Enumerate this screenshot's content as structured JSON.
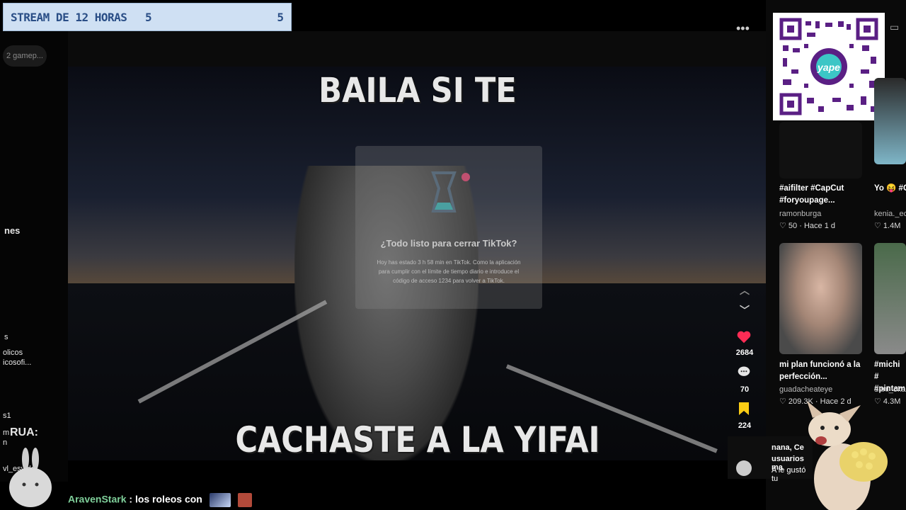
{
  "scoreboard": {
    "label": "STREAM DE 12 HORAS",
    "score_left": "5",
    "score_right": "5"
  },
  "left_chat": {
    "chip": "2 gamep...",
    "fragments": [
      "nes",
      "s",
      "olicos",
      "icosofi...",
      "s1",
      "RUA:",
      "m",
      "n",
      "vl_esvida"
    ]
  },
  "video": {
    "caption_top": "BAILA SI TE",
    "caption_bottom": "CACHASTE A LA YIFAI",
    "dialog_title": "¿Todo listo para cerrar TikTok?",
    "dialog_body": "Hoy has estado 3 h 58 min en TikTok. Como la aplicación para cumplir con el límite de tiempo diario e introduce el código de acceso 1234 para volver a TikTok."
  },
  "actions": {
    "more": "•••",
    "likes": "2684",
    "comments": "70",
    "saves": "224",
    "colors": {
      "like": "#fe2c55",
      "save": "#facc15"
    }
  },
  "cards": [
    {
      "title": "#aifilter #CapCut #foryoupage...",
      "user": "ramonburga",
      "likes": "50",
      "time": "Hace 1 d"
    },
    {
      "title": "Yo 😝 #C #popula",
      "user": "kenia._ec",
      "likes": "1.4M",
      "time": ""
    },
    {
      "title": "mi plan funcionó a la perfección...",
      "user": "guadacheateye",
      "likes": "209.3K",
      "time": "Hace 2 d"
    },
    {
      "title": "#michi # #pintam",
      "user": "dani_okas",
      "likes": "4.3M",
      "time": ""
    }
  ],
  "notification": {
    "line1": "nana, Ce",
    "line2": "usuarios ma",
    "line3": "A le gustó tu"
  },
  "chat": {
    "user": "AravenStark",
    "message": ": los roleos con"
  }
}
